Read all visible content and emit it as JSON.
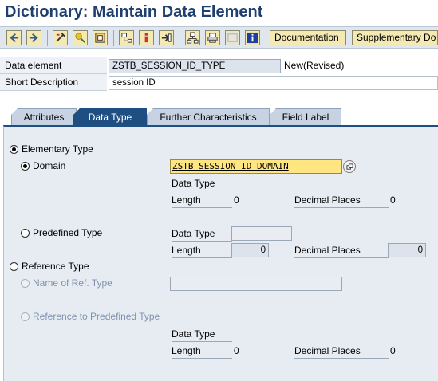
{
  "title": "Dictionary: Maintain Data Element",
  "toolbar": {
    "documentation_label": "Documentation",
    "supplementary_label": "Supplementary Do"
  },
  "header": {
    "data_element_label": "Data element",
    "data_element_value": "ZSTB_SESSION_ID_TYPE",
    "status": "New(Revised)",
    "short_desc_label": "Short Description",
    "short_desc_value": "session ID"
  },
  "tabs": [
    {
      "label": "Attributes",
      "active": false
    },
    {
      "label": "Data Type",
      "active": true
    },
    {
      "label": "Further Characteristics",
      "active": false
    },
    {
      "label": "Field Label",
      "active": false
    }
  ],
  "panel": {
    "elementary_type": "Elementary Type",
    "domain": "Domain",
    "domain_value": "ZSTB_SESSION_ID_DOMAIN",
    "data_type_label": "Data Type",
    "length_label": "Length",
    "decimal_places_label": "Decimal Places",
    "domain_length": "0",
    "domain_decimals": "0",
    "predefined_type": "Predefined Type",
    "predef_data_type_label": "Data Type",
    "predef_length_label": "Length",
    "predef_length_value": "0",
    "predef_decimal_label": "Decimal Places",
    "predef_decimal_value": "0",
    "reference_type": "Reference Type",
    "name_of_ref_type": "Name of Ref. Type",
    "ref_to_predefined": "Reference to Predefined Type",
    "ref_data_type_label": "Data Type",
    "ref_length_label": "Length",
    "ref_length_value": "0",
    "ref_decimal_label": "Decimal Places",
    "ref_decimal_value": "0"
  }
}
